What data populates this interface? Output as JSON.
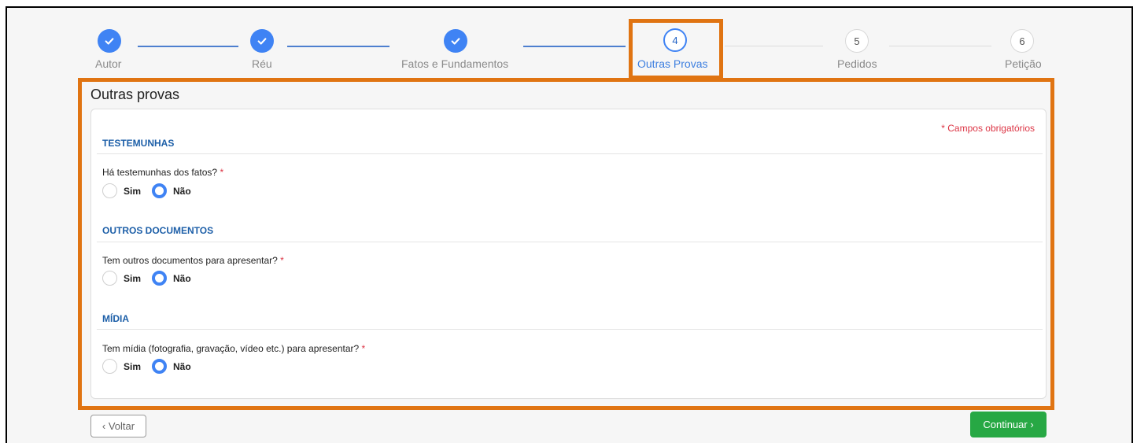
{
  "stepper": {
    "steps": [
      {
        "number": "1",
        "label": "Autor",
        "state": "done"
      },
      {
        "number": "2",
        "label": "Réu",
        "state": "done"
      },
      {
        "number": "3",
        "label": "Fatos e Fundamentos",
        "state": "done"
      },
      {
        "number": "4",
        "label": "Outras Provas",
        "state": "current"
      },
      {
        "number": "5",
        "label": "Pedidos",
        "state": "pending"
      },
      {
        "number": "6",
        "label": "Petição",
        "state": "pending"
      }
    ]
  },
  "form": {
    "title": "Outras provas",
    "required_note": "* Campos obrigatórios",
    "sections": [
      {
        "title": "TESTEMUNHAS",
        "question": "Há testemunhas dos fatos?",
        "required_mark": "*",
        "options": [
          "Sim",
          "Não"
        ],
        "selected": "Não"
      },
      {
        "title": "OUTROS DOCUMENTOS",
        "question": "Tem outros documentos para apresentar?",
        "required_mark": "*",
        "options": [
          "Sim",
          "Não"
        ],
        "selected": "Não"
      },
      {
        "title": "MÍDIA",
        "question": "Tem mídia (fotografia, gravação, vídeo etc.) para apresentar?",
        "required_mark": "*",
        "options": [
          "Sim",
          "Não"
        ],
        "selected": "Não"
      }
    ]
  },
  "footer": {
    "back_label": "‹ Voltar",
    "continue_label": "Continuar ›"
  },
  "colors": {
    "accent": "#3f83f4",
    "highlight": "#e07412",
    "success": "#27a844",
    "required": "#dc3545"
  }
}
